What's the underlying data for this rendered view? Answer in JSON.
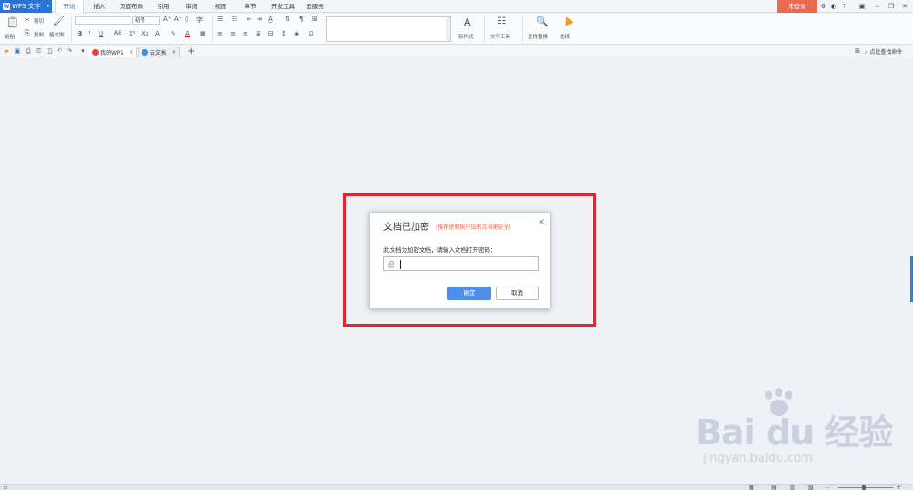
{
  "menubar": {
    "app_name": "WPS 文字",
    "tabs": [
      "开始",
      "插入",
      "页面布局",
      "引用",
      "审阅",
      "视图",
      "章节",
      "开发工具",
      "云服务"
    ],
    "login_label": "未登录",
    "window_controls": [
      "settings-icon",
      "skin-icon",
      "help-icon",
      "ribbon-toggle-icon",
      "minimize-icon",
      "restore-icon",
      "close-icon"
    ]
  },
  "ribbon": {
    "paste_label": "粘贴",
    "cut_label": "剪切",
    "copy_label": "复制",
    "format_painter_label": "格式刷",
    "font_size_value": "初号",
    "new_style_label": "新样式",
    "text_tool_label": "文字工具",
    "find_replace_label": "查找替换",
    "select_label": "选择"
  },
  "tabs": {
    "my_wps": "我的WPS",
    "cloud_docs": "云文档",
    "search_command": "点此查找命令"
  },
  "dialog": {
    "title": "文档已加密",
    "hint": "(推荐使用账户加密文档更安全)",
    "message": "此文档为加密文档，请输入文档打开密码：",
    "password_value": "",
    "ok_label": "确定",
    "cancel_label": "取消"
  },
  "watermark": {
    "main": "Bai du 经验",
    "sub": "jingyan.baidu.com"
  },
  "colors": {
    "accent": "#2b74d6",
    "login": "#e96a4f",
    "highlight": "#e3262d",
    "ok_button": "#4e8ee8"
  }
}
